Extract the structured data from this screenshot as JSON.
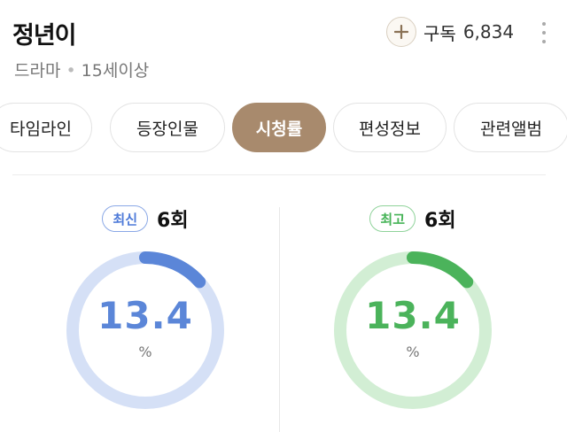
{
  "header": {
    "title": "정년이",
    "genre": "드라마",
    "rating": "15세이상",
    "subscribe_label": "구독",
    "subscriber_count": "6,834"
  },
  "tabs": [
    {
      "label": "타임라인",
      "active": false
    },
    {
      "label": "등장인물",
      "active": false
    },
    {
      "label": "시청률",
      "active": true
    },
    {
      "label": "편성정보",
      "active": false
    },
    {
      "label": "관련앨범",
      "active": false
    }
  ],
  "stats": {
    "latest": {
      "badge": "최신",
      "episode": "6회",
      "value": "13.4",
      "unit": "%",
      "ring_fill_fraction": 0.134,
      "color": "#5b86d8",
      "track_color": "#d5e0f6"
    },
    "highest": {
      "badge": "최고",
      "episode": "6회",
      "value": "13.4",
      "unit": "%",
      "ring_fill_fraction": 0.134,
      "color": "#4bb35b",
      "track_color": "#d2eed4"
    }
  },
  "icons": {
    "subscribe": "plus-icon",
    "more": "more-vertical-icon"
  },
  "colors": {
    "accent_tab": "#a88a6d"
  }
}
